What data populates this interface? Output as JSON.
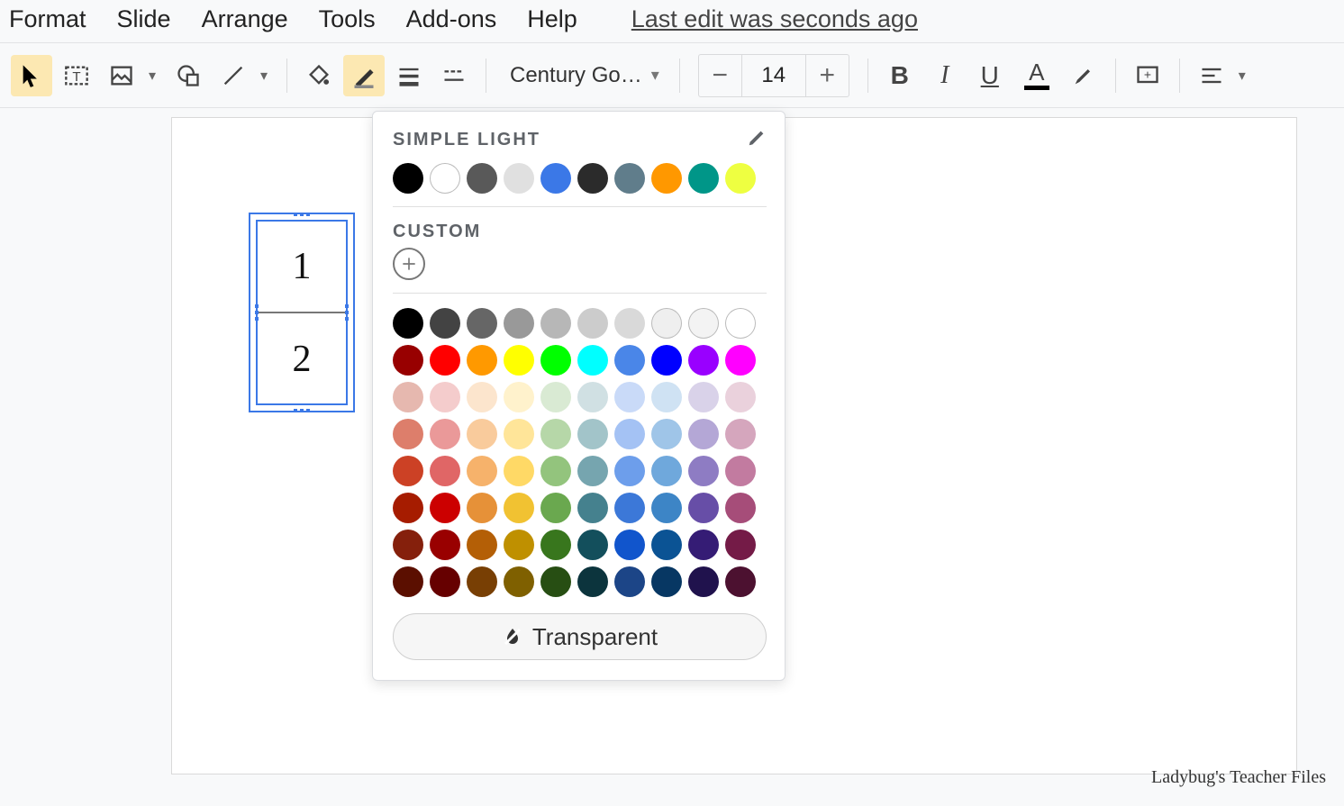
{
  "menu": {
    "items": [
      "Format",
      "Slide",
      "Arrange",
      "Tools",
      "Add-ons",
      "Help"
    ],
    "last_edit": "Last edit was seconds ago"
  },
  "toolbar": {
    "font_name": "Century Go…",
    "font_size": "14"
  },
  "table": {
    "cell1": "1",
    "cell2": "2"
  },
  "color_picker": {
    "theme_title": "SIMPLE LIGHT",
    "custom_title": "CUSTOM",
    "transparent_label": "Transparent",
    "theme_colors": [
      {
        "hex": "#000000"
      },
      {
        "hex": "#ffffff",
        "bordered": true
      },
      {
        "hex": "#595959"
      },
      {
        "hex": "#e0e0e0"
      },
      {
        "hex": "#3b78e7"
      },
      {
        "hex": "#2b2b2b"
      },
      {
        "hex": "#607d8b"
      },
      {
        "hex": "#ff9800"
      },
      {
        "hex": "#009688"
      },
      {
        "hex": "#eeff41"
      }
    ],
    "grid": [
      [
        "#000000",
        "#434343",
        "#666666",
        "#999999",
        "#b7b7b7",
        "#cccccc",
        "#d9d9d9",
        "#efefef",
        "#f3f3f3",
        "#ffffff"
      ],
      [
        "#980000",
        "#ff0000",
        "#ff9900",
        "#ffff00",
        "#00ff00",
        "#00ffff",
        "#4a86e8",
        "#0000ff",
        "#9900ff",
        "#ff00ff"
      ],
      [
        "#e6b8af",
        "#f4cccc",
        "#fce5cd",
        "#fff2cc",
        "#d9ead3",
        "#d0e0e3",
        "#c9daf8",
        "#cfe2f3",
        "#d9d2e9",
        "#ead1dc"
      ],
      [
        "#dd7e6b",
        "#ea9999",
        "#f9cb9c",
        "#ffe599",
        "#b6d7a8",
        "#a2c4c9",
        "#a4c2f4",
        "#9fc5e8",
        "#b4a7d6",
        "#d5a6bd"
      ],
      [
        "#cc4125",
        "#e06666",
        "#f6b26b",
        "#ffd966",
        "#93c47d",
        "#76a5af",
        "#6d9eeb",
        "#6fa8dc",
        "#8e7cc3",
        "#c27ba0"
      ],
      [
        "#a61c00",
        "#cc0000",
        "#e69138",
        "#f1c232",
        "#6aa84f",
        "#45818e",
        "#3c78d8",
        "#3d85c6",
        "#674ea7",
        "#a64d79"
      ],
      [
        "#85200c",
        "#990000",
        "#b45f06",
        "#bf9000",
        "#38761d",
        "#134f5c",
        "#1155cc",
        "#0b5394",
        "#351c75",
        "#741b47"
      ],
      [
        "#5b0f00",
        "#660000",
        "#783f04",
        "#7f6000",
        "#274e13",
        "#0c343d",
        "#1c4587",
        "#073763",
        "#20124d",
        "#4c1130"
      ]
    ]
  },
  "watermark": "Ladybug's Teacher Files"
}
